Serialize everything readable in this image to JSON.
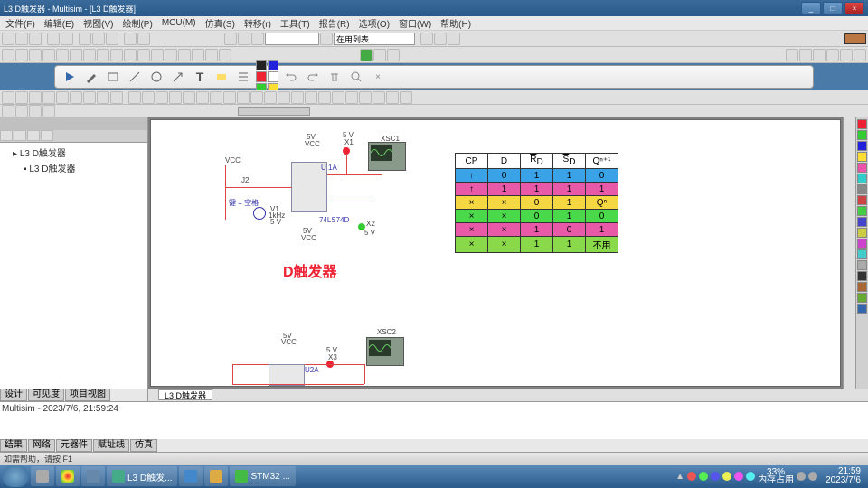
{
  "window": {
    "title": "L3 D触发器 - Multisim - [L3 D触发器]",
    "min": "_",
    "max": "□",
    "close": "×"
  },
  "menu": [
    "文件(F)",
    "编辑(E)",
    "视图(V)",
    "绘制(P)",
    "MCU(M)",
    "仿真(S)",
    "转移(r)",
    "工具(T)",
    "报告(R)",
    "选项(O)",
    "窗口(W)",
    "帮助(H)"
  ],
  "combo1": "",
  "combo2": "在用列表",
  "tree": {
    "root": "L3 D触发器",
    "child": "L3 D触发器"
  },
  "sheet_tab": "L3 D触发器",
  "sch": {
    "vcc1": "VCC",
    "fivev1": "5V",
    "x1": "X1",
    "x1v": "5 V",
    "xsc1": "XSC1",
    "j2": "J2",
    "fgen": "键 = 空格",
    "v1": "V1",
    "v1hz": "1kHz",
    "v1v": "5 V",
    "u1a": "U 1A",
    "ic": "74LS74D",
    "x2": "X2",
    "x2v": "5 V",
    "vcc2": "VCC",
    "fivev2": "5V",
    "title": "D触发器",
    "vcc3": "VCC",
    "fivev3": "5V",
    "x3": "X3",
    "x3v": "5 V",
    "xsc2": "XSC2",
    "u2a": "U2A"
  },
  "truth": {
    "headers": [
      "CP",
      "D",
      "R̅ᴅ",
      "S̅ᴅ",
      "Qⁿ⁺¹"
    ],
    "rows": [
      {
        "color": "#3aa3e8",
        "cells": [
          "↑",
          "0",
          "1",
          "1",
          "0"
        ]
      },
      {
        "color": "#e85aa8",
        "cells": [
          "↑",
          "1",
          "1",
          "1",
          "1"
        ]
      },
      {
        "color": "#f5d742",
        "cells": [
          "×",
          "×",
          "0",
          "1",
          "Qⁿ"
        ]
      },
      {
        "color": "#4ad94a",
        "cells": [
          "×",
          "×",
          "0",
          "1",
          "0"
        ]
      },
      {
        "color": "#e85aa8",
        "cells": [
          "×",
          "×",
          "1",
          "0",
          "1"
        ]
      },
      {
        "color": "#8ad94a",
        "cells": [
          "×",
          "×",
          "1",
          "1",
          "不用"
        ]
      }
    ]
  },
  "bp_tabs_top": [
    "设计",
    "可见度",
    "项目视图"
  ],
  "bp_tabs_bot": [
    "结果",
    "网络",
    "元器件",
    "赋址线",
    "仿真"
  ],
  "log": "Multisim - 2023/7/6, 21:59:24",
  "status": "如需帮助，请按 F1",
  "taskbar": {
    "items": [
      "",
      "",
      "",
      "",
      "L3 D触发...",
      "",
      "",
      "STM32 ..."
    ],
    "bat": "33%",
    "mem": "内存占用",
    "time": "21:59",
    "date": "2023/7/6"
  },
  "colors": {
    "annot": [
      "#222",
      "#22d",
      "#e23",
      "#fff",
      "#3c3",
      "#fd3"
    ]
  },
  "strip_colors": [
    "#e23",
    "#3c3",
    "#22d",
    "#fd3",
    "#e5a",
    "#3cc",
    "#888",
    "#c44",
    "#4c4",
    "#44c",
    "#cc4",
    "#c4c",
    "#4cc",
    "#aaa",
    "#333",
    "#a63",
    "#6a3",
    "#36a"
  ]
}
